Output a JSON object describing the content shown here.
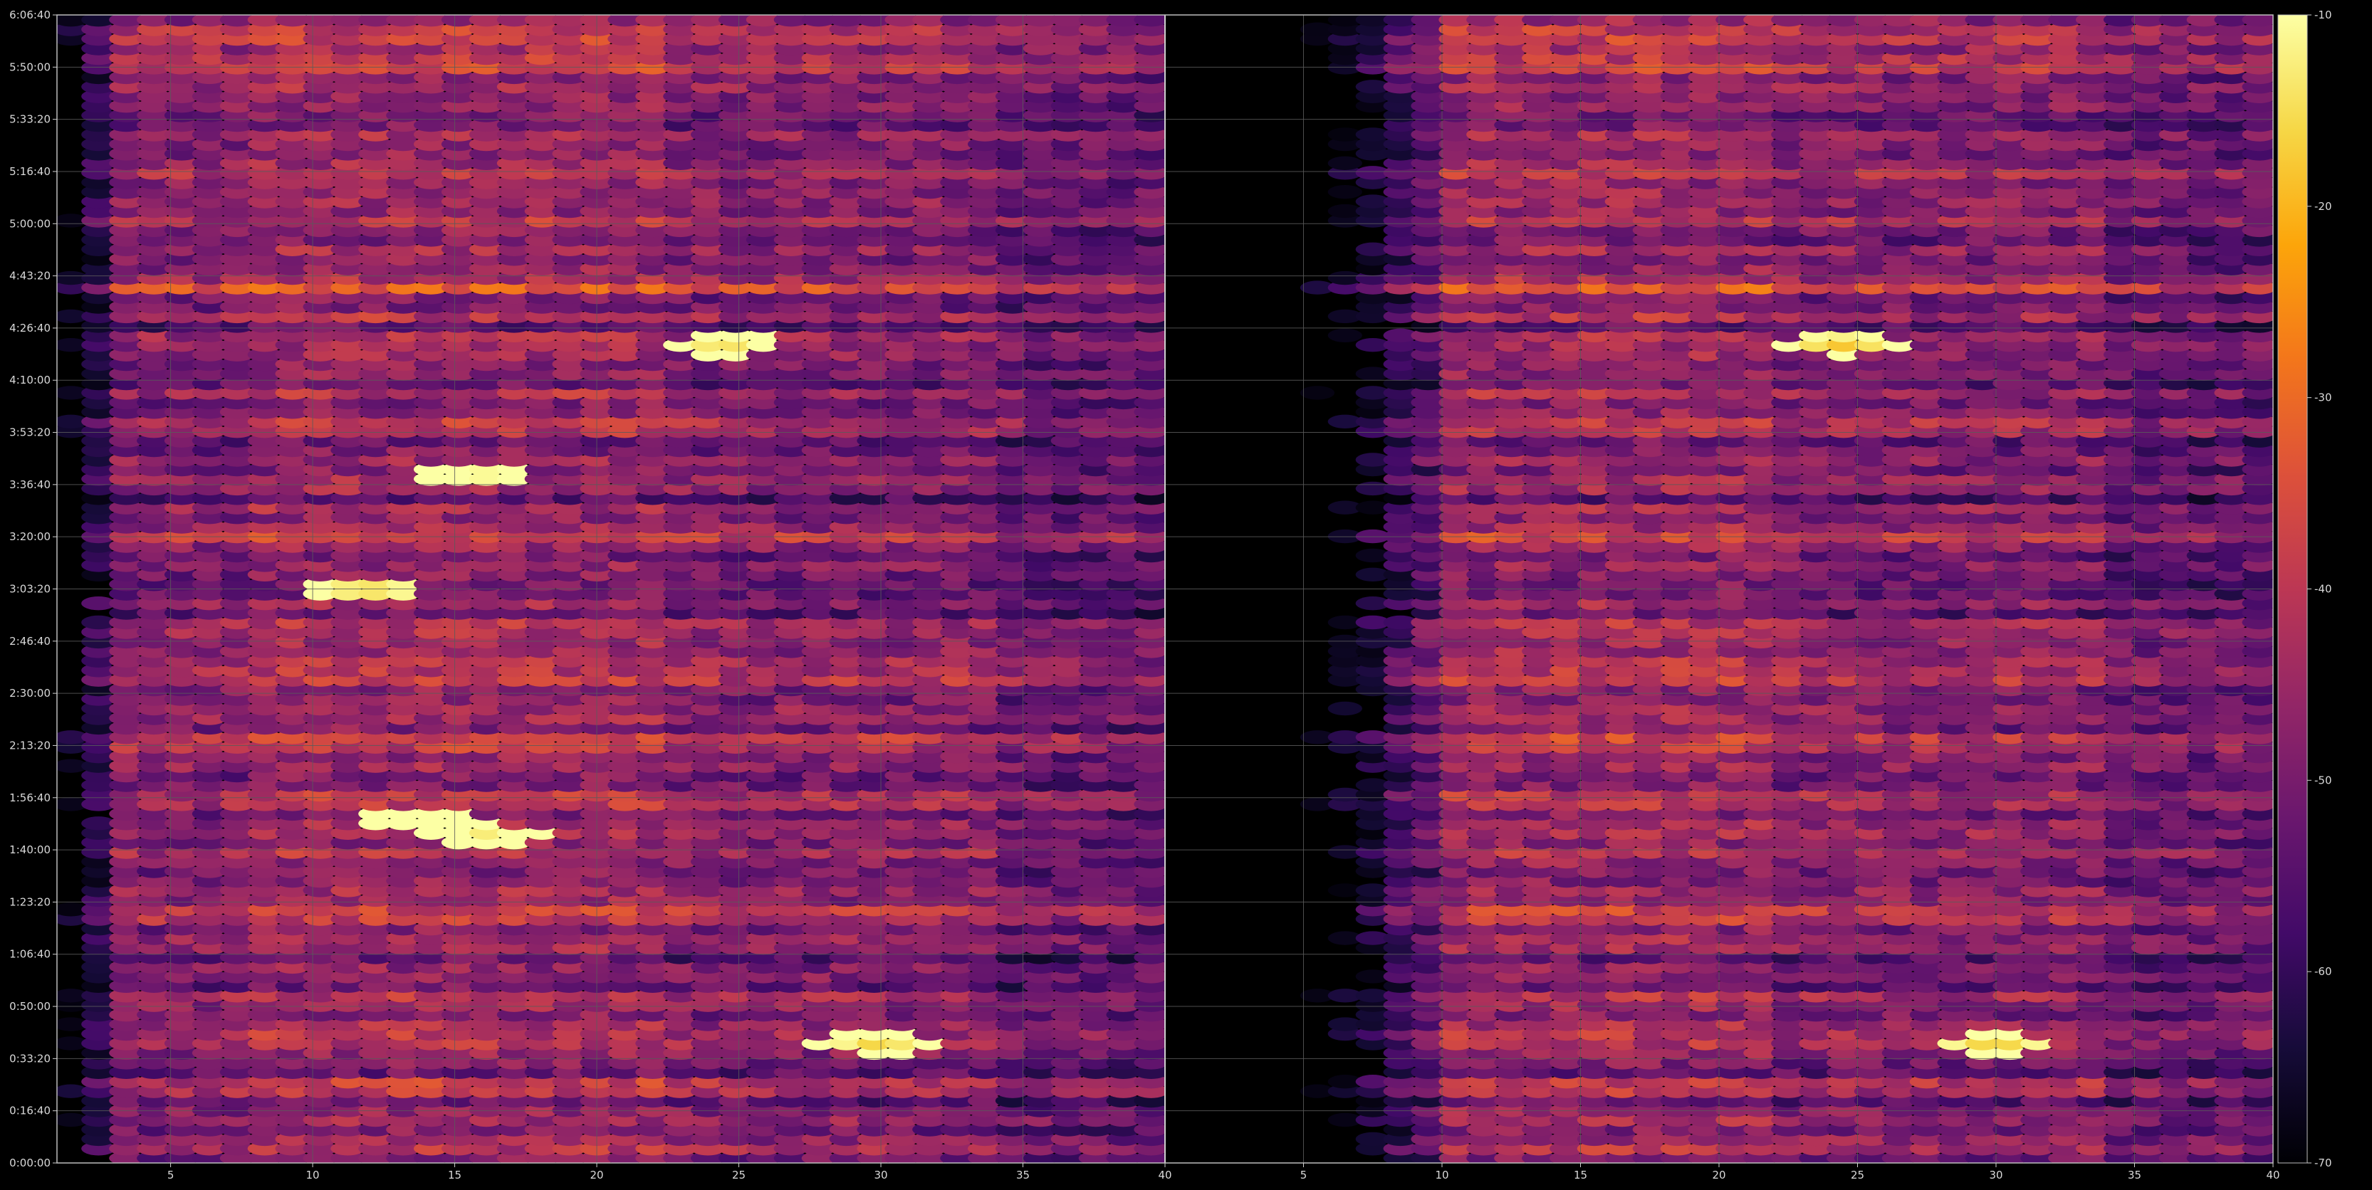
{
  "chart_data": {
    "type": "heatmap",
    "title": "",
    "xlabel": "",
    "ylabel": "",
    "grid": true,
    "colormap": "inferno",
    "background": "#000000",
    "gridline_color": "#5a5a5a",
    "panels": [
      {
        "name": "",
        "x_range": [
          1,
          40
        ],
        "x_ticks": [
          5,
          10,
          15,
          20,
          25,
          30,
          35
        ],
        "description_shape": "no blank columns",
        "dark_until": 1,
        "fade_until": 3
      },
      {
        "name": "",
        "x_range": [
          0,
          40
        ],
        "x_ticks": [
          5,
          10,
          15,
          20,
          25,
          30,
          35,
          40
        ],
        "dark_until": 5,
        "fade_until": 10
      }
    ],
    "boundary_tick": "40",
    "y_range_seconds": [
      0,
      22000
    ],
    "y_ticks": [
      {
        "value": 0,
        "label": "0:00:00"
      },
      {
        "value": 1000,
        "label": "0:16:40"
      },
      {
        "value": 2000,
        "label": "0:33:20"
      },
      {
        "value": 3000,
        "label": "0:50:00"
      },
      {
        "value": 4000,
        "label": "1:06:40"
      },
      {
        "value": 5000,
        "label": "1:23:20"
      },
      {
        "value": 6000,
        "label": "1:40:00"
      },
      {
        "value": 7000,
        "label": "1:56:40"
      },
      {
        "value": 8000,
        "label": "2:13:20"
      },
      {
        "value": 9000,
        "label": "2:30:00"
      },
      {
        "value": 10000,
        "label": "2:46:40"
      },
      {
        "value": 11000,
        "label": "3:03:20"
      },
      {
        "value": 12000,
        "label": "3:20:00"
      },
      {
        "value": 13000,
        "label": "3:36:40"
      },
      {
        "value": 14000,
        "label": "3:53:20"
      },
      {
        "value": 15000,
        "label": "4:10:00"
      },
      {
        "value": 16000,
        "label": "4:26:40"
      },
      {
        "value": 17000,
        "label": "4:43:20"
      },
      {
        "value": 18000,
        "label": "5:00:00"
      },
      {
        "value": 19000,
        "label": "5:16:40"
      },
      {
        "value": 20000,
        "label": "5:33:20"
      },
      {
        "value": 21000,
        "label": "5:50:00"
      },
      {
        "value": 22000,
        "label": "6:06:40"
      }
    ],
    "colorbar": {
      "range": [
        -70,
        -10
      ],
      "ticks": [
        {
          "value": -10,
          "label": "-10"
        },
        {
          "value": -20,
          "label": "-20"
        },
        {
          "value": -30,
          "label": "-30"
        },
        {
          "value": -40,
          "label": "-40"
        },
        {
          "value": -50,
          "label": "-50"
        },
        {
          "value": -60,
          "label": "-60"
        },
        {
          "value": -70,
          "label": "-70"
        }
      ]
    },
    "time_rows": 120,
    "bright_bands_seconds": [
      21600,
      21000,
      19000,
      18300,
      16800,
      14300,
      12100,
      9300,
      8050,
      6400,
      6050,
      4800,
      2450,
      1450
    ],
    "hot_spots": [
      {
        "panel": 0,
        "x": 13.5,
        "y": 6600,
        "level": -13
      },
      {
        "panel": 0,
        "x": 16,
        "y": 6300,
        "level": -14
      },
      {
        "panel": 0,
        "x": 16,
        "y": 13200,
        "level": -15
      },
      {
        "panel": 0,
        "x": 24.5,
        "y": 15700,
        "level": -16
      },
      {
        "panel": 0,
        "x": 12,
        "y": 11000,
        "level": -18
      },
      {
        "panel": 0,
        "x": 30,
        "y": 2300,
        "level": -17
      },
      {
        "panel": 1,
        "x": 30,
        "y": 2300,
        "level": -18
      },
      {
        "panel": 1,
        "x": 24.5,
        "y": 15700,
        "level": -19
      }
    ]
  }
}
